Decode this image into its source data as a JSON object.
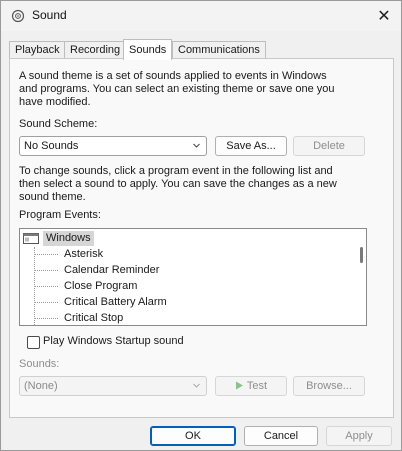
{
  "window": {
    "title": "Sound",
    "close_glyph": "✕",
    "app_icon": "speaker-icon"
  },
  "tabs": [
    {
      "label": "Playback",
      "active": false
    },
    {
      "label": "Recording",
      "active": false
    },
    {
      "label": "Sounds",
      "active": true
    },
    {
      "label": "Communications",
      "active": false
    }
  ],
  "sounds": {
    "intro": [
      "A sound theme is a set of sounds applied to events in Windows",
      "and programs.  You can select an existing theme or save one you",
      "have modified."
    ],
    "scheme_label": "Sound Scheme:",
    "scheme_value": "No Sounds",
    "save_as_label": "Save As...",
    "delete_label": "Delete",
    "change_text": [
      "To change sounds, click a program event in the following list and",
      "then select a sound to apply.  You can save the changes as a new",
      "sound theme."
    ],
    "events_label": "Program Events:",
    "events_root": "Windows",
    "events": [
      "Asterisk",
      "Calendar Reminder",
      "Close Program",
      "Critical Battery Alarm",
      "Critical Stop"
    ],
    "startup_label": "Play Windows Startup sound",
    "startup_checked": false,
    "sounds_label": "Sounds:",
    "sound_value": "(None)",
    "test_label": "Test",
    "browse_label": "Browse..."
  },
  "footer": {
    "ok_label": "OK",
    "cancel_label": "Cancel",
    "apply_label": "Apply"
  },
  "colors": {
    "accent": "#005fb8",
    "disabled_text": "#8e8e8e"
  }
}
